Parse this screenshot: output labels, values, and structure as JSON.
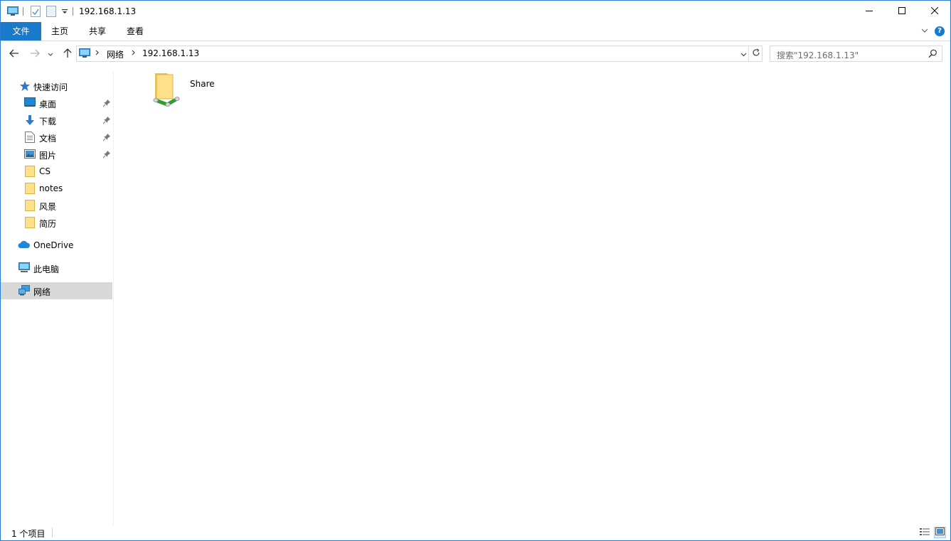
{
  "window": {
    "title": "192.168.1.13",
    "accent": "#1979ca"
  },
  "titlebar": {
    "quick_access_icons": [
      "computer-icon",
      "properties-icon",
      "new-folder-icon",
      "customize-dropdown-icon"
    ],
    "min_icon": "minimize-icon",
    "max_icon": "maximize-icon",
    "close_icon": "close-icon"
  },
  "ribbon": {
    "tabs": [
      {
        "label": "文件"
      },
      {
        "label": "主页"
      },
      {
        "label": "共享"
      },
      {
        "label": "查看"
      }
    ],
    "help": "?"
  },
  "address": {
    "crumbs": [
      "网络",
      "192.168.1.13"
    ],
    "search_placeholder": "搜索\"192.168.1.13\""
  },
  "sidebar": {
    "quick_access": "快速访问",
    "items": [
      {
        "label": "桌面",
        "icon": "desktop-icon",
        "pinned": true
      },
      {
        "label": "下载",
        "icon": "download-icon",
        "pinned": true
      },
      {
        "label": "文档",
        "icon": "document-icon",
        "pinned": true
      },
      {
        "label": "图片",
        "icon": "pictures-icon",
        "pinned": true
      },
      {
        "label": "CS",
        "icon": "folder-icon",
        "pinned": false
      },
      {
        "label": "notes",
        "icon": "folder-icon",
        "pinned": false
      },
      {
        "label": "风景",
        "icon": "folder-icon",
        "pinned": false
      },
      {
        "label": "简历",
        "icon": "folder-icon",
        "pinned": false
      }
    ],
    "onedrive": "OneDrive",
    "this_pc": "此电脑",
    "network": "网络"
  },
  "content": {
    "items": [
      {
        "name": "Share",
        "icon": "network-share-icon"
      }
    ]
  },
  "status": {
    "count": "1 个项目"
  }
}
